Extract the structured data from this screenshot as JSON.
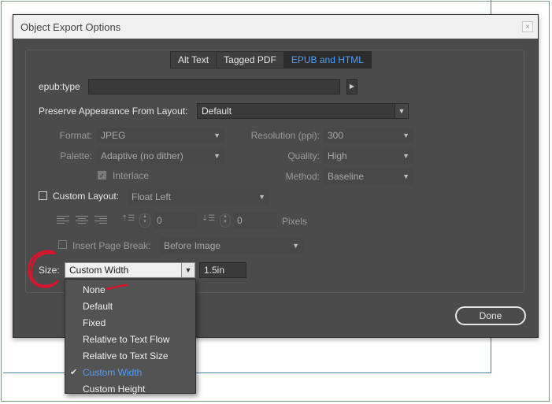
{
  "dialog": {
    "title": "Object Export Options"
  },
  "tabs": [
    {
      "label": "Alt Text",
      "active": false
    },
    {
      "label": "Tagged PDF",
      "active": false
    },
    {
      "label": "EPUB and HTML",
      "active": true
    }
  ],
  "epub_type": {
    "label": "epub:type",
    "value": "",
    "arrow": "▶"
  },
  "preserve": {
    "label": "Preserve Appearance From Layout:",
    "value": "Default"
  },
  "format": {
    "label": "Format:",
    "value": "JPEG"
  },
  "resolution": {
    "label": "Resolution (ppi):",
    "value": "300"
  },
  "palette": {
    "label": "Palette:",
    "value": "Adaptive (no dither)"
  },
  "quality": {
    "label": "Quality:",
    "value": "High"
  },
  "interlace": {
    "label": "Interlace",
    "checked": true
  },
  "method": {
    "label": "Method:",
    "value": "Baseline"
  },
  "custom_layout": {
    "label": "Custom Layout:",
    "value": "Float Left",
    "checked": false
  },
  "spacing": {
    "left_value": "0",
    "right_value": "0",
    "unit": "Pixels"
  },
  "page_break": {
    "label": "Insert Page Break:",
    "value": "Before Image",
    "checked": false
  },
  "size": {
    "label": "Size:",
    "value": "Custom Width",
    "width_value": "1.5in"
  },
  "size_menu": {
    "items": [
      {
        "label": "None",
        "selected": false
      },
      {
        "label": "Default",
        "selected": false
      },
      {
        "label": "Fixed",
        "selected": false
      },
      {
        "label": "Relative to Text Flow",
        "selected": false
      },
      {
        "label": "Relative to Text Size",
        "selected": false
      },
      {
        "label": "Custom Width",
        "selected": true
      },
      {
        "label": "Custom Height",
        "selected": false
      }
    ],
    "check_glyph": "✔"
  },
  "buttons": {
    "done": "Done",
    "close": "×"
  },
  "colors": {
    "accent": "#4d9fff",
    "annotation": "#d9142a",
    "dialog_bg": "#4b4b4b"
  }
}
